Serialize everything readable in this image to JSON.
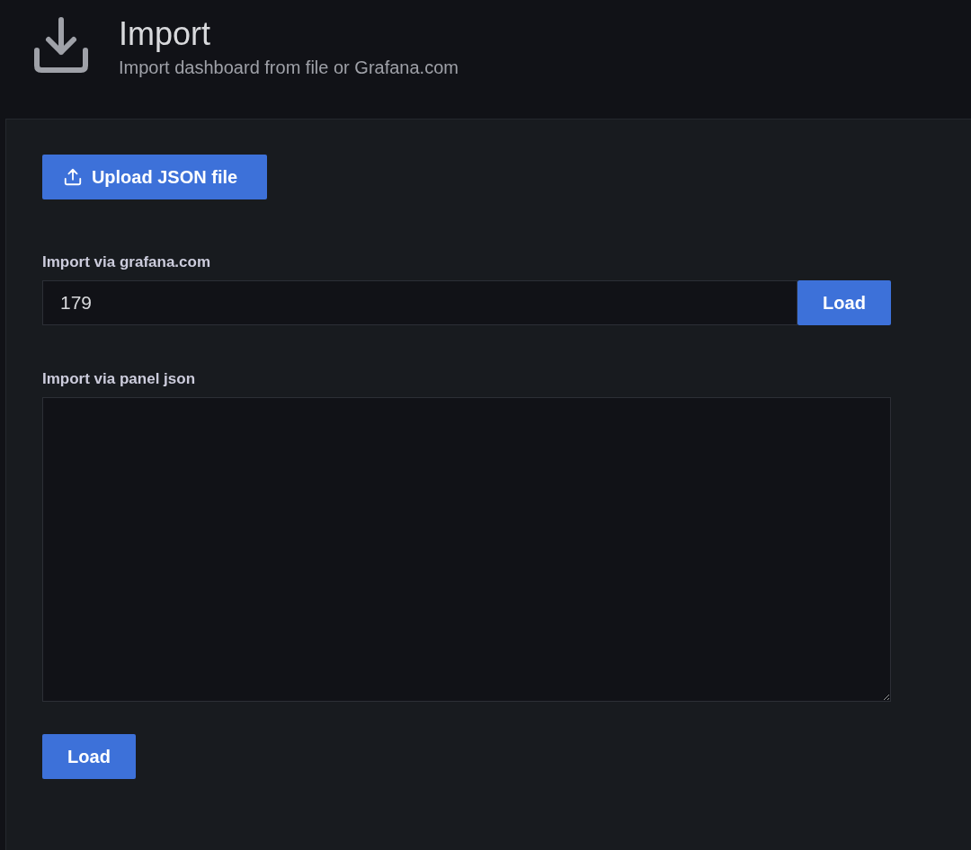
{
  "header": {
    "title": "Import",
    "subtitle": "Import dashboard from file or Grafana.com"
  },
  "upload_button": {
    "label": "Upload JSON file"
  },
  "grafana_import": {
    "label": "Import via grafana.com",
    "value": "179",
    "button": "Load"
  },
  "panel_json_import": {
    "label": "Import via panel json",
    "button": "Load"
  }
}
